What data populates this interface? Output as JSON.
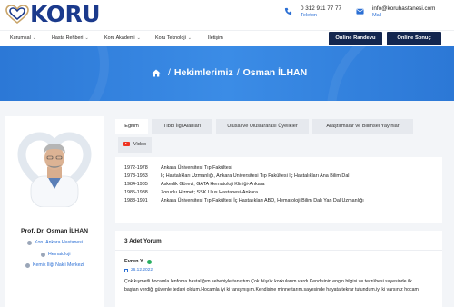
{
  "brand": {
    "logo_text": "KORU",
    "colors": {
      "primary": "#1b3a8c",
      "accent": "#2b6fd4",
      "dark_button": "#13264f",
      "banner": "#2c78d6"
    }
  },
  "contact": {
    "phone": {
      "value": "0 312 911 77 77",
      "label": "Telefon",
      "icon": "phone-icon"
    },
    "mail": {
      "value": "info@koruhastanesi.com",
      "label": "Mail",
      "icon": "mail-icon"
    }
  },
  "nav": {
    "items": [
      {
        "label": "Kurumsal",
        "dropdown": true
      },
      {
        "label": "Hasta Rehberi",
        "dropdown": true
      },
      {
        "label": "Koru Akademi",
        "dropdown": true
      },
      {
        "label": "Koru Teknoloji",
        "dropdown": true
      },
      {
        "label": "İletişim",
        "dropdown": false
      }
    ],
    "chevron": "⌄",
    "online_appointment": "Online Randevu",
    "online_result": "Online Sonuç"
  },
  "breadcrumb": {
    "sep": "/",
    "section": "Hekimlerimiz",
    "current": "Osman İLHAN"
  },
  "doctor": {
    "name": "Prof. Dr. Osman İLHAN",
    "hospital": "Koru Ankara Hastanesi",
    "department": "Hematoloji",
    "center": "Kemik İliği Nakli Merkezi"
  },
  "tabs": [
    {
      "label": "Eğitim",
      "active": true
    },
    {
      "label": "Tıbbi İlgi Alanları",
      "active": false
    },
    {
      "label": "Ulusal ve Uluslararası Üyelikler",
      "active": false
    },
    {
      "label": "Araştırmalar ve Bilimsel Yayınlar",
      "active": false
    },
    {
      "label": "Video",
      "active": false
    }
  ],
  "education": [
    {
      "years": "1972-1978",
      "text": "Ankara Üniversitesi Tıp Fakültesi"
    },
    {
      "years": "1978-1983",
      "text": "İç Hastalıkları Uzmanlığı, Ankara Üniversitesi Tıp Fakültesi İç Hastalıkları Ana Bilim Dalı"
    },
    {
      "years": "1984-1985",
      "text": "Askerlik Görevi; GATA Hematoloji Kliniği-Ankara"
    },
    {
      "years": "1985-1988",
      "text": "Zorunlu Hizmet; SSK Ulus Hastanesi-Ankara"
    },
    {
      "years": "1988-1991",
      "text": "Ankara Üniversitesi Tıp Fakültesi İç Hastalıkları ABD, Hematoloji Bilim Dalı Yan Dal Uzmanlığı"
    }
  ],
  "comments": {
    "title": "3 Adet Yorum",
    "items": [
      {
        "author": "Evren Y.",
        "date": "26.12.2022",
        "text": "Çok kıymetli hocamla lenfoma hastalığım sebebiyle tanıştım.Çok büyük korkularım vardı.Kendisinin engin bilgisi ve tecrübesi sayesinde ilk baştan verdiği güvenle tedavi oldum.Hocamla iyi ki tanışmışım.Kendisine minnettarım.sayesinde hayata tekrar tutundum.iyi ki varsınız hocam."
      }
    ]
  }
}
